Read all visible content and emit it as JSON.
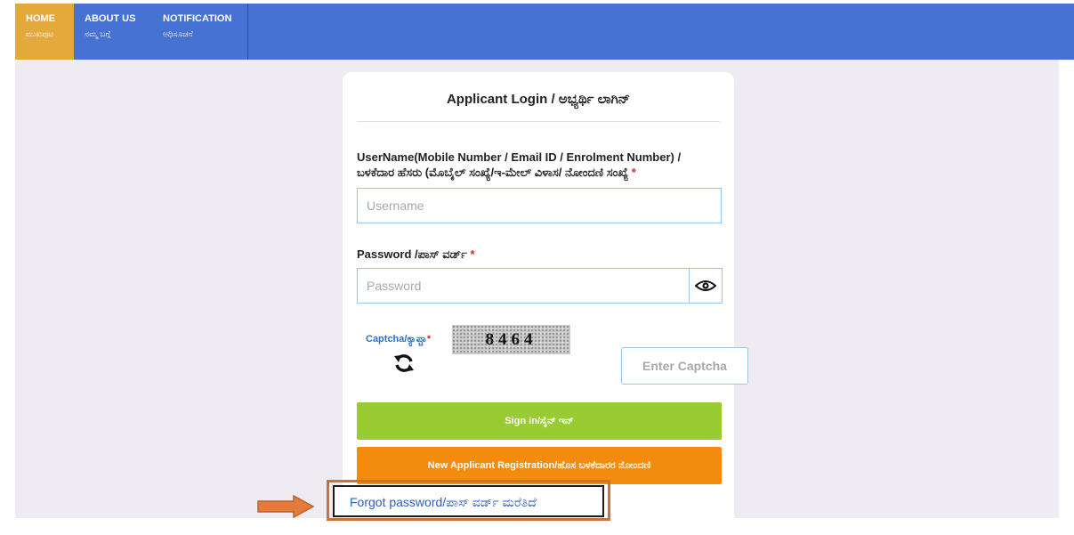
{
  "nav": {
    "home": {
      "label": "HOME",
      "sub": "ಮುಖಪುಟ"
    },
    "about": {
      "label": "ABOUT US",
      "sub": "ನಮ್ಮ ಬಗ್ಗೆ"
    },
    "notification": {
      "label": "NOTIFICATION",
      "sub": "ಅಧಿಸೂಚನೆ"
    }
  },
  "login": {
    "title": "Applicant Login / ಅಭ್ಯರ್ಥಿ ಲಾಗಿನ್",
    "username_label_line1": "UserName(Mobile Number / Email ID / Enrolment Number) /",
    "username_label_line2": "ಬಳಕೆದಾರ ಹೆಸರು (ಮೊಬೈಲ್ ಸಂಖ್ಯೆ/ಇ-ಮೇಲ್ ವಿಳಾಸ/ ನೋಂದಣಿ ಸಂಖ್ಯೆ",
    "required_mark": "*",
    "username_placeholder": "Username",
    "password_label": "Password /ಪಾಸ್ ವರ್ಡ್",
    "password_placeholder": "Password",
    "captcha_label": "Captcha/ಕ್ಯಾಪ್ಚಾ",
    "captcha_code": "8464",
    "captcha_placeholder": "Enter Captcha",
    "signin_label": "Sign in/ಸೈನ್ ಇನ್",
    "register_label": "New Applicant Registration/ಹೊಸ ಬಳಕೆದಾರರ ನೋಂದಣಿ",
    "forgot_label": "Forgot password/ಪಾಸ್ ವರ್ಡ್ ಮರೆತಿದೆ"
  },
  "colors": {
    "nav_bg": "#4672d3",
    "nav_active": "#e4a93c",
    "page_bg": "#eeebf3",
    "signin_btn": "#99cc33",
    "register_btn": "#f38b0f",
    "highlight": "#c8733b"
  },
  "icons": [
    "eye-icon",
    "refresh-icon",
    "arrow-right-icon"
  ]
}
